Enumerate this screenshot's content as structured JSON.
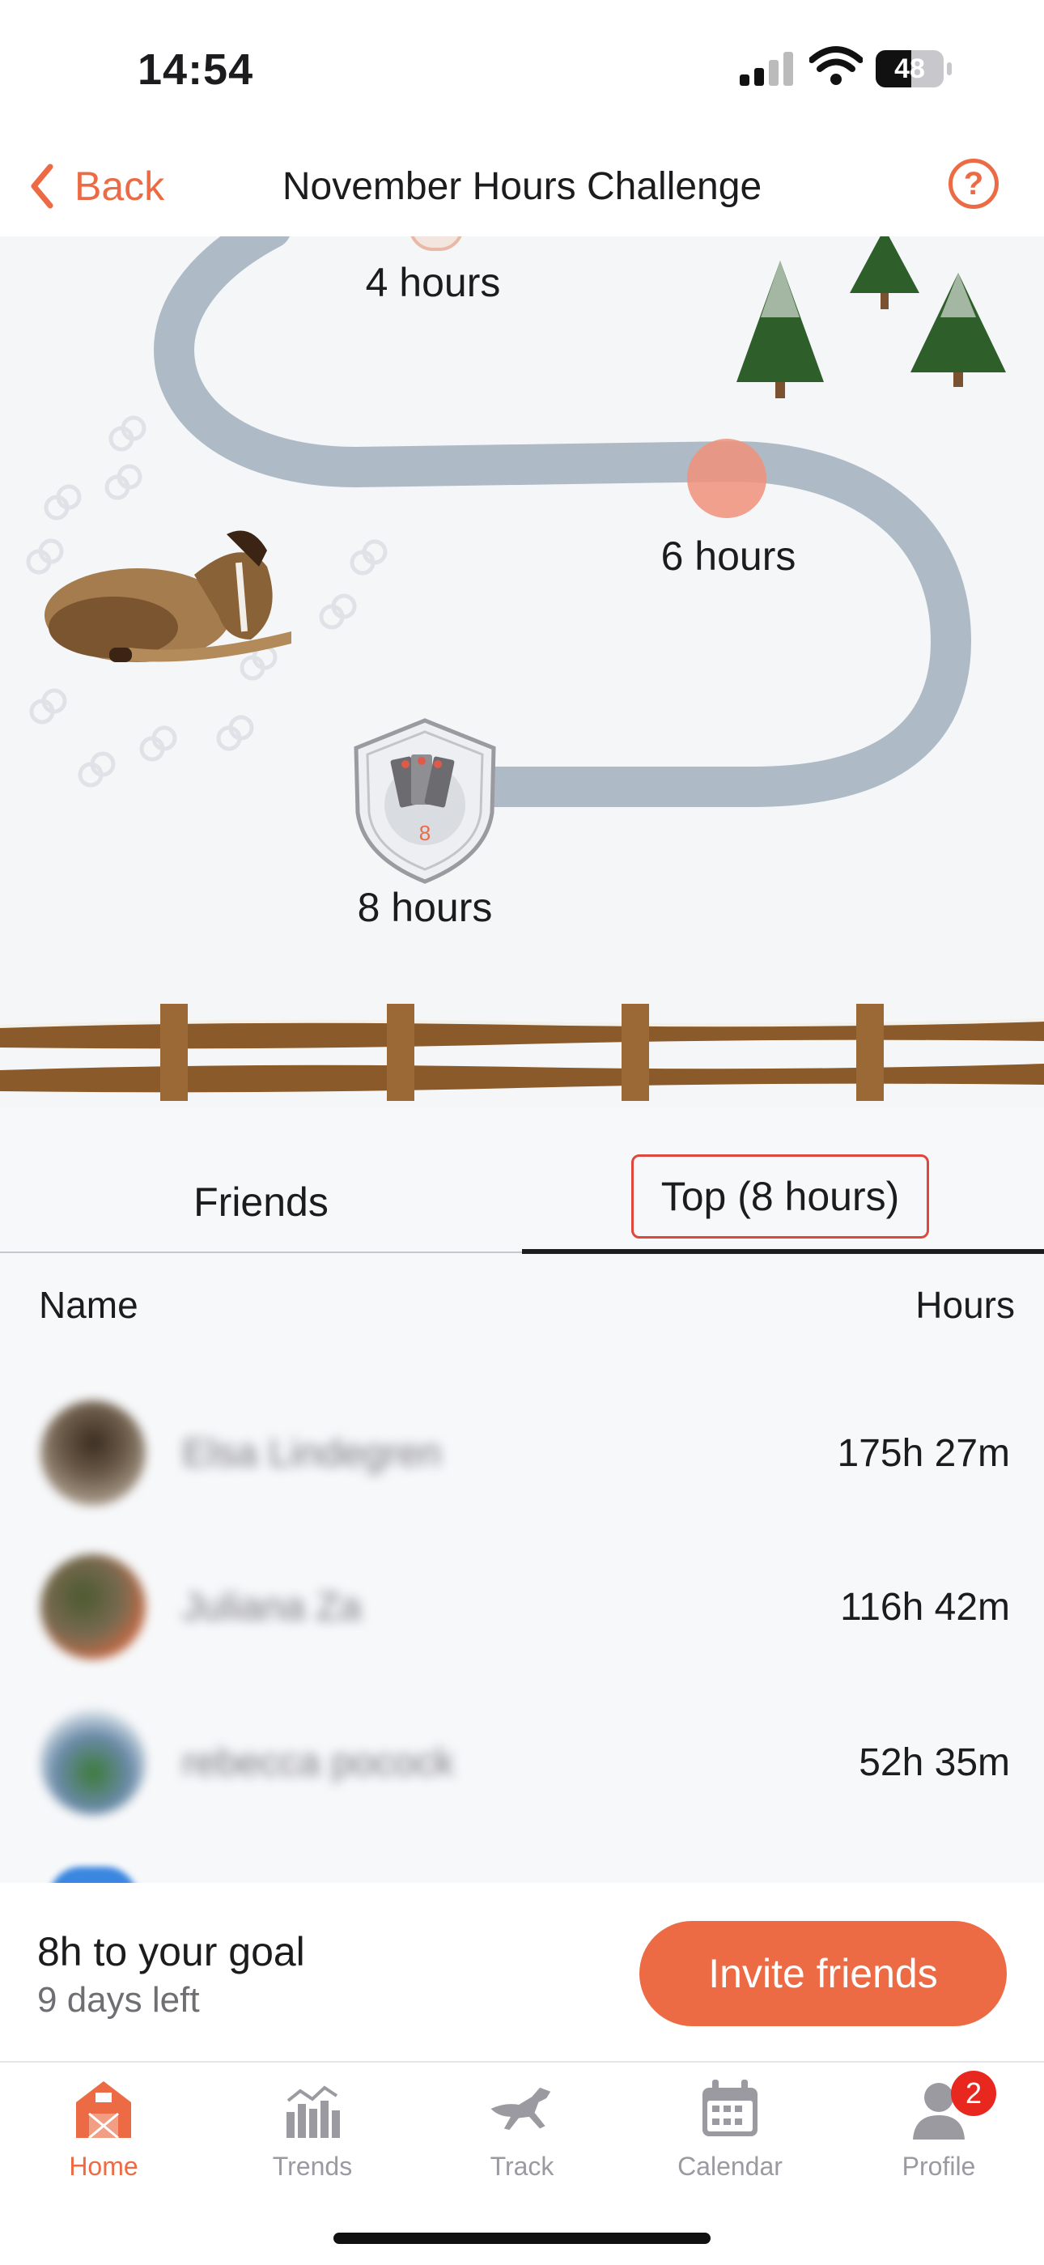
{
  "status": {
    "time": "14:54",
    "battery": "48"
  },
  "nav": {
    "back_label": "Back",
    "title": "November Hours Challenge",
    "help_icon": "question-circle-icon"
  },
  "map": {
    "milestones": [
      {
        "label": "4 hours"
      },
      {
        "label": "6 hours"
      },
      {
        "label": "8 hours",
        "badge_number": "8"
      }
    ]
  },
  "tabs": [
    {
      "label": "Friends"
    },
    {
      "label": "Top (8 hours)"
    }
  ],
  "table": {
    "columns": {
      "name": "Name",
      "hours": "Hours"
    },
    "rows": [
      {
        "name": "Elsa Lindegren",
        "hours": "175h 27m"
      },
      {
        "name": "Juliana Za",
        "hours": "116h 42m"
      },
      {
        "name": "rebecca pocock",
        "hours": "52h 35m"
      }
    ]
  },
  "goal": {
    "text": "8h to your goal",
    "days_left": "9 days left",
    "invite_label": "Invite friends"
  },
  "tabbar": {
    "items": [
      {
        "label": "Home",
        "icon": "barn-icon"
      },
      {
        "label": "Trends",
        "icon": "bar-chart-icon"
      },
      {
        "label": "Track",
        "icon": "horse-icon"
      },
      {
        "label": "Calendar",
        "icon": "calendar-icon"
      },
      {
        "label": "Profile",
        "icon": "person-icon",
        "badge": "2"
      }
    ]
  },
  "colors": {
    "accent": "#ec6b44",
    "path": "#aebbc7",
    "active_tab": "#1c1c1e"
  }
}
